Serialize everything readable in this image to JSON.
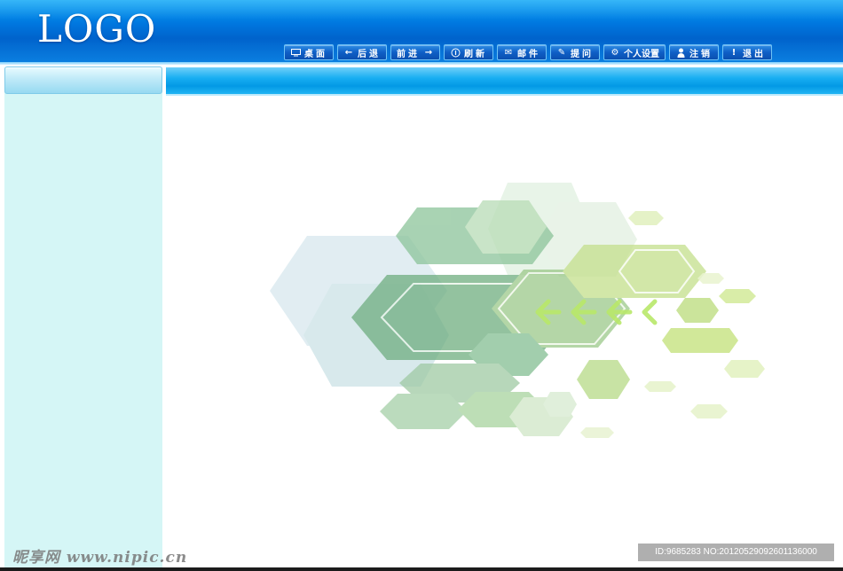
{
  "header": {
    "logo": "LOGO"
  },
  "toolbar": {
    "buttons": [
      {
        "label": "桌面",
        "icon": "desktop-icon"
      },
      {
        "label": "后退",
        "icon": "arrow-left-icon"
      },
      {
        "label": "前进",
        "icon": "arrow-right-icon"
      },
      {
        "label": "刷新",
        "icon": "refresh-icon"
      },
      {
        "label": "邮件",
        "icon": "mail-icon"
      },
      {
        "label": "提问",
        "icon": "pencil-icon"
      },
      {
        "label": "个人设置",
        "icon": "gear-icon"
      },
      {
        "label": "注销",
        "icon": "user-icon"
      },
      {
        "label": "退出",
        "icon": "exclamation-icon"
      }
    ]
  },
  "colors": {
    "header_top": "#0aa6f6",
    "header_mid": "#0063cc",
    "sidebar_bg": "#d5f6f6",
    "panel_head": "#18aef2",
    "hex_green": "#7fbf7f",
    "hex_lime": "#b5d86a",
    "hex_blue": "#a9cfd8"
  },
  "watermark": {
    "left": "昵享网 www.nipic.cn",
    "right": "ID:9685283 NO:20120529092601136000"
  }
}
